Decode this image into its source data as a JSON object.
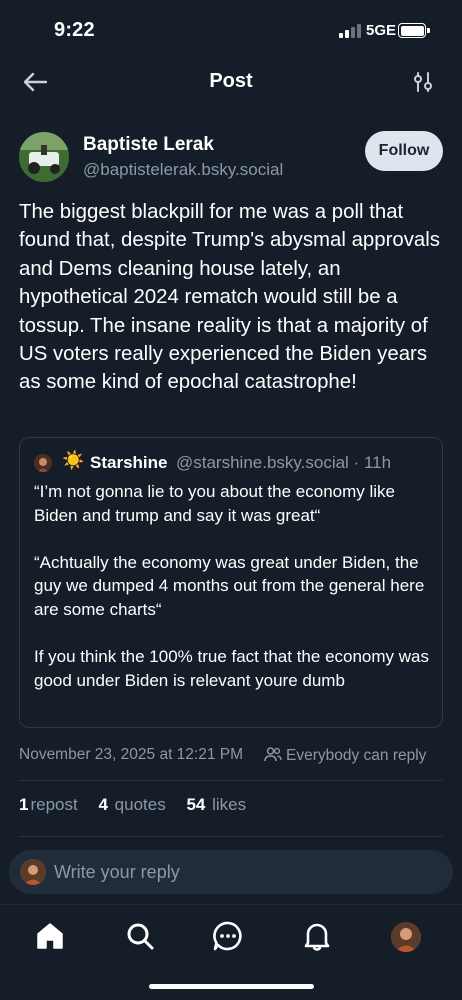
{
  "status_bar": {
    "time": "9:22",
    "network": "5GE"
  },
  "header": {
    "title": "Post",
    "back_icon": "arrow-left-icon",
    "filter_icon": "sliders-icon"
  },
  "post": {
    "author": {
      "name": "Baptiste Lerak",
      "handle": "@baptistelerak.bsky.social",
      "avatar_icon": "lawnmower-avatar"
    },
    "follow_label": "Follow",
    "text": "The biggest blackpill for me was a poll that found that, despite Trump's abysmal approvals and Dems cleaning house lately, an hypothetical 2024 rematch would still be a tossup. The insane reality is that a majority of US voters really experienced the Biden years as some kind of epochal catastrophe!",
    "quote": {
      "emoji": "☀️",
      "name": "Starshine",
      "meta": "@starshine.bsky.social · 11h",
      "paragraphs": [
        "“I’m not gonna lie to you about the economy like Biden and trump and say it was great“",
        "“Achtually the economy was great under Biden, the guy we dumped 4 months out from the general here are some charts“",
        "If you think the 100% true fact that the economy was good under Biden is relevant youre dumb"
      ]
    },
    "timestamp": "November 23, 2025 at 12:21 PM",
    "reply_setting": "Everybody can reply",
    "stats": {
      "reposts_count": "1",
      "reposts_label": "repost",
      "quotes_count": "4",
      "quotes_label": "quotes",
      "likes_count": "54",
      "likes_label": "likes"
    }
  },
  "reply_bar": {
    "placeholder": "Write your reply"
  },
  "tab_bar": {
    "items": [
      "home-icon",
      "search-icon",
      "chat-icon",
      "bell-icon",
      "profile-avatar"
    ]
  },
  "colors": {
    "background": "#151d28",
    "muted_text": "#8b98a9",
    "follow_button_bg": "#dfe5ec",
    "border": "#2d3a4b"
  }
}
